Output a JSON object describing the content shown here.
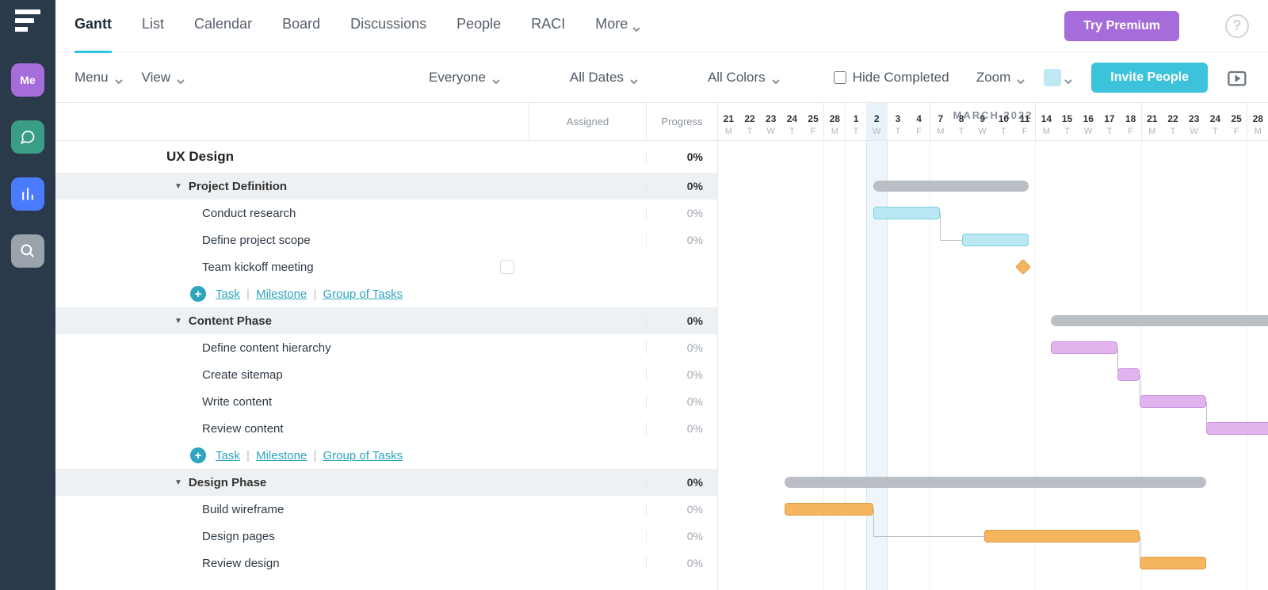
{
  "left_rail": {
    "me": "Me"
  },
  "nav": {
    "tabs": [
      "Gantt",
      "List",
      "Calendar",
      "Board",
      "Discussions",
      "People",
      "RACI"
    ],
    "more": "More",
    "premium": "Try Premium"
  },
  "toolbar": {
    "menu": "Menu",
    "view": "View",
    "everyone": "Everyone",
    "all_dates": "All Dates",
    "all_colors": "All Colors",
    "hide_completed": "Hide Completed",
    "zoom": "Zoom",
    "invite": "Invite People"
  },
  "columns": {
    "assigned": "Assigned",
    "progress": "Progress"
  },
  "month": "MARCH 2022",
  "days": [
    {
      "n": "21",
      "w": "M"
    },
    {
      "n": "22",
      "w": "T"
    },
    {
      "n": "23",
      "w": "W"
    },
    {
      "n": "24",
      "w": "T"
    },
    {
      "n": "25",
      "w": "F"
    },
    {
      "n": "28",
      "w": "M",
      "wk": true
    },
    {
      "n": "1",
      "w": "T",
      "wk": true
    },
    {
      "n": "2",
      "w": "W",
      "today": true
    },
    {
      "n": "3",
      "w": "T"
    },
    {
      "n": "4",
      "w": "F"
    },
    {
      "n": "7",
      "w": "M",
      "wk": true
    },
    {
      "n": "8",
      "w": "T"
    },
    {
      "n": "9",
      "w": "W"
    },
    {
      "n": "10",
      "w": "T"
    },
    {
      "n": "11",
      "w": "F"
    },
    {
      "n": "14",
      "w": "M",
      "wk": true
    },
    {
      "n": "15",
      "w": "T"
    },
    {
      "n": "16",
      "w": "W"
    },
    {
      "n": "17",
      "w": "T"
    },
    {
      "n": "18",
      "w": "F"
    },
    {
      "n": "21",
      "w": "M",
      "wk": true
    },
    {
      "n": "22",
      "w": "T"
    },
    {
      "n": "23",
      "w": "W"
    },
    {
      "n": "24",
      "w": "T"
    },
    {
      "n": "25",
      "w": "F"
    },
    {
      "n": "28",
      "w": "M",
      "wk": true
    }
  ],
  "project": {
    "name": "UX Design",
    "progress": "0%"
  },
  "groups": [
    {
      "name": "Project Definition",
      "progress": "0%",
      "bar_start": 7,
      "bar_len": 7,
      "tasks": [
        {
          "name": "Conduct research",
          "progress": "0%",
          "color": "cy",
          "start": 7,
          "len": 3
        },
        {
          "name": "Define project scope",
          "progress": "0%",
          "color": "cy",
          "start": 11,
          "len": 3
        },
        {
          "name": "Team kickoff meeting",
          "progress": "",
          "milestone": true,
          "color": "or",
          "start": 13.5
        }
      ]
    },
    {
      "name": "Content Phase",
      "progress": "0%",
      "bar_start": 15,
      "bar_len": 11,
      "tasks": [
        {
          "name": "Define content hierarchy",
          "progress": "0%",
          "color": "pu",
          "start": 15,
          "len": 3
        },
        {
          "name": "Create sitemap",
          "progress": "0%",
          "color": "pu",
          "start": 18,
          "len": 1
        },
        {
          "name": "Write content",
          "progress": "0%",
          "color": "pu",
          "start": 19,
          "len": 3
        },
        {
          "name": "Review content",
          "progress": "0%",
          "color": "pu",
          "start": 22,
          "len": 3
        }
      ]
    },
    {
      "name": "Design Phase",
      "progress": "0%",
      "bar_start": 3,
      "bar_len": 19,
      "tasks": [
        {
          "name": "Build wireframe",
          "progress": "0%",
          "color": "or",
          "start": 3,
          "len": 4
        },
        {
          "name": "Design pages",
          "progress": "0%",
          "color": "or",
          "start": 12,
          "len": 7
        },
        {
          "name": "Review design",
          "progress": "0%",
          "color": "or",
          "start": 19,
          "len": 3
        }
      ]
    }
  ],
  "add_links": {
    "task": "Task",
    "milestone": "Milestone",
    "group": "Group of Tasks"
  }
}
